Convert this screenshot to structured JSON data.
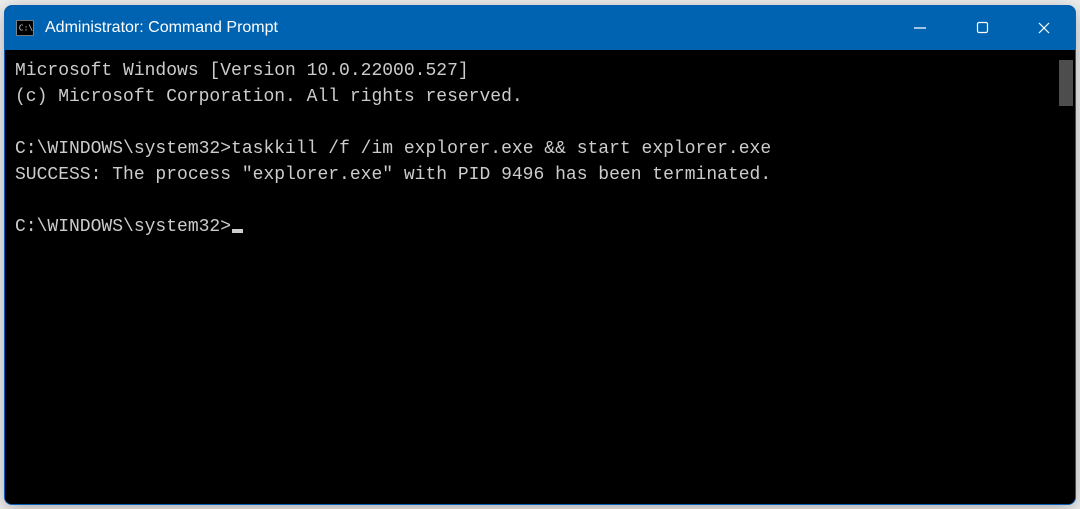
{
  "window": {
    "title": "Administrator: Command Prompt"
  },
  "terminal": {
    "lines": {
      "l0": "Microsoft Windows [Version 10.0.22000.527]",
      "l1": "(c) Microsoft Corporation. All rights reserved.",
      "l2": "",
      "l3_prompt": "C:\\WINDOWS\\system32>",
      "l3_cmd": "taskkill /f /im explorer.exe && start explorer.exe",
      "l4": "SUCCESS: The process \"explorer.exe\" with PID 9496 has been terminated.",
      "l5": "",
      "l6_prompt": "C:\\WINDOWS\\system32>"
    }
  }
}
